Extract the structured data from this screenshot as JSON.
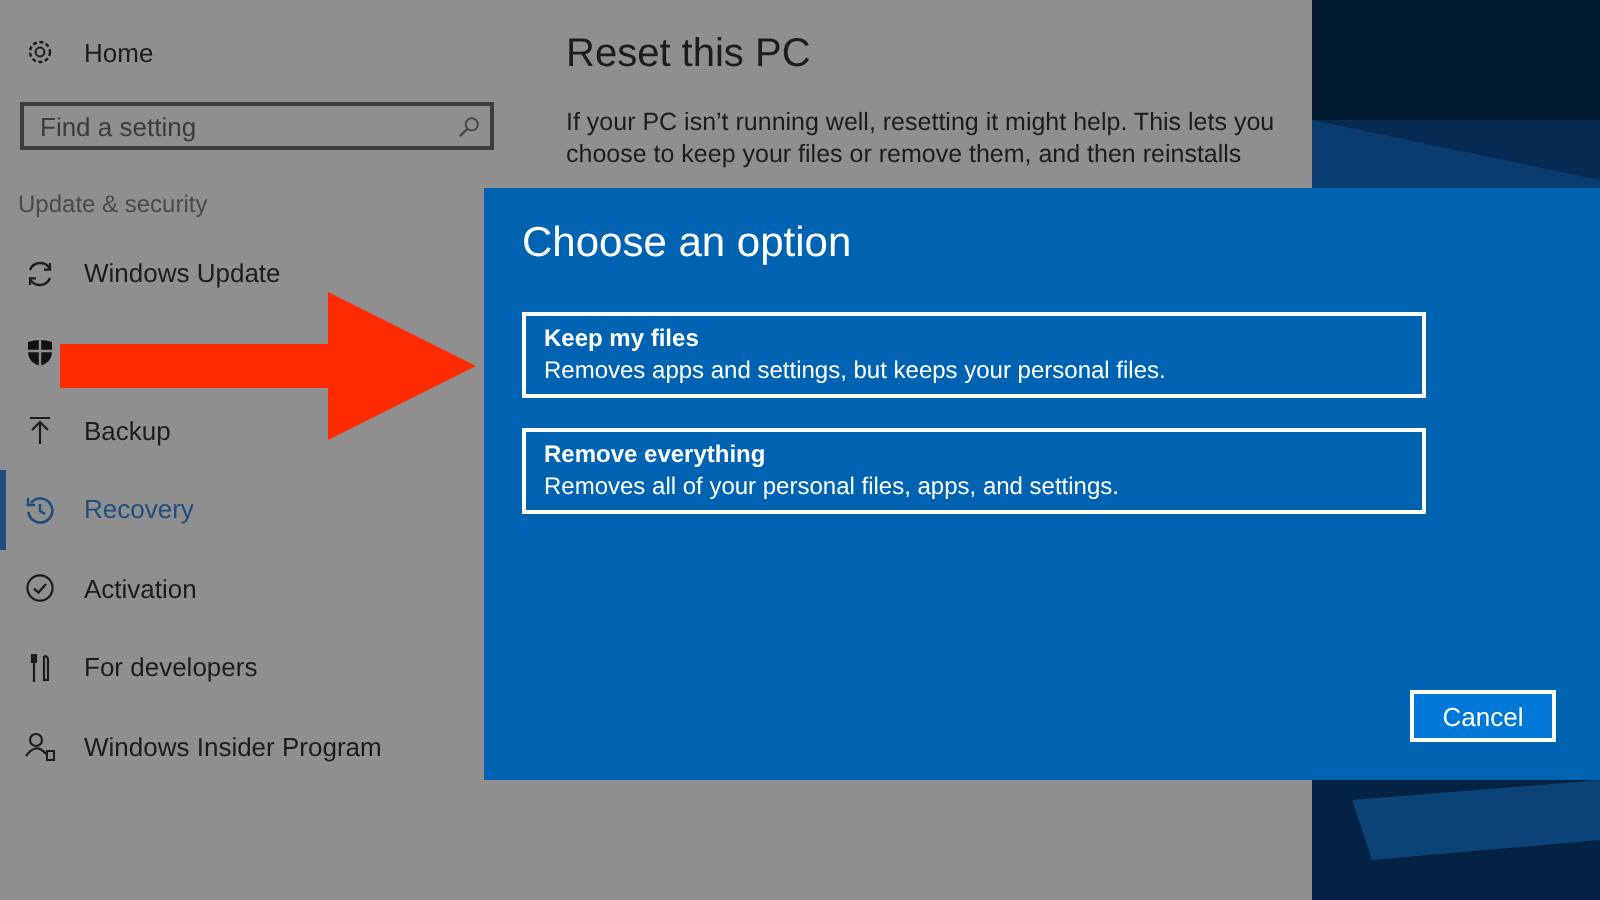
{
  "sidebar": {
    "home": "Home",
    "search": {
      "placeholder": "Find a setting"
    },
    "section": "Update & security",
    "items": [
      {
        "label": "Windows Update",
        "selected": false
      },
      {
        "selected": false
      },
      {
        "label": "Backup",
        "selected": false
      },
      {
        "label": "Recovery",
        "selected": true
      },
      {
        "label": "Activation",
        "selected": false
      },
      {
        "label": "For developers",
        "selected": false
      },
      {
        "label": "Windows Insider Program",
        "selected": false
      }
    ]
  },
  "main": {
    "title": "Reset this PC",
    "description": "If your PC isn’t running well, resetting it might help. This lets you choose to keep your files or remove them, and then reinstalls"
  },
  "dialog": {
    "title": "Choose an option",
    "options": [
      {
        "title": "Keep my files",
        "description": "Removes apps and settings, but keeps your personal files."
      },
      {
        "title": "Remove everything",
        "description": "Removes all of your personal files, apps, and settings."
      }
    ],
    "buttons": [
      "Cancel"
    ]
  }
}
